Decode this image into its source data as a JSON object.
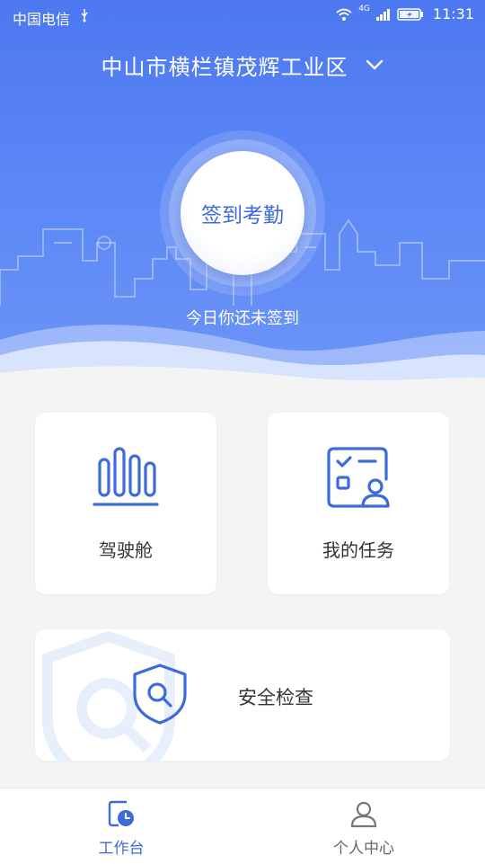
{
  "status_bar": {
    "carrier": "中国电信",
    "network": "4G",
    "time": "11:31"
  },
  "header": {
    "location": "中山市横栏镇茂辉工业区"
  },
  "checkin": {
    "button_label": "签到考勤",
    "status_text": "今日你还未签到"
  },
  "cards": {
    "cockpit_label": "驾驶舱",
    "tasks_label": "我的任务",
    "safety_label": "安全检查"
  },
  "tabbar": {
    "work_label": "工作台",
    "profile_label": "个人中心"
  },
  "colors": {
    "accent": "#3d6bdc",
    "hero_top": "#4d78f0",
    "hero_bottom": "#6d95f7"
  }
}
